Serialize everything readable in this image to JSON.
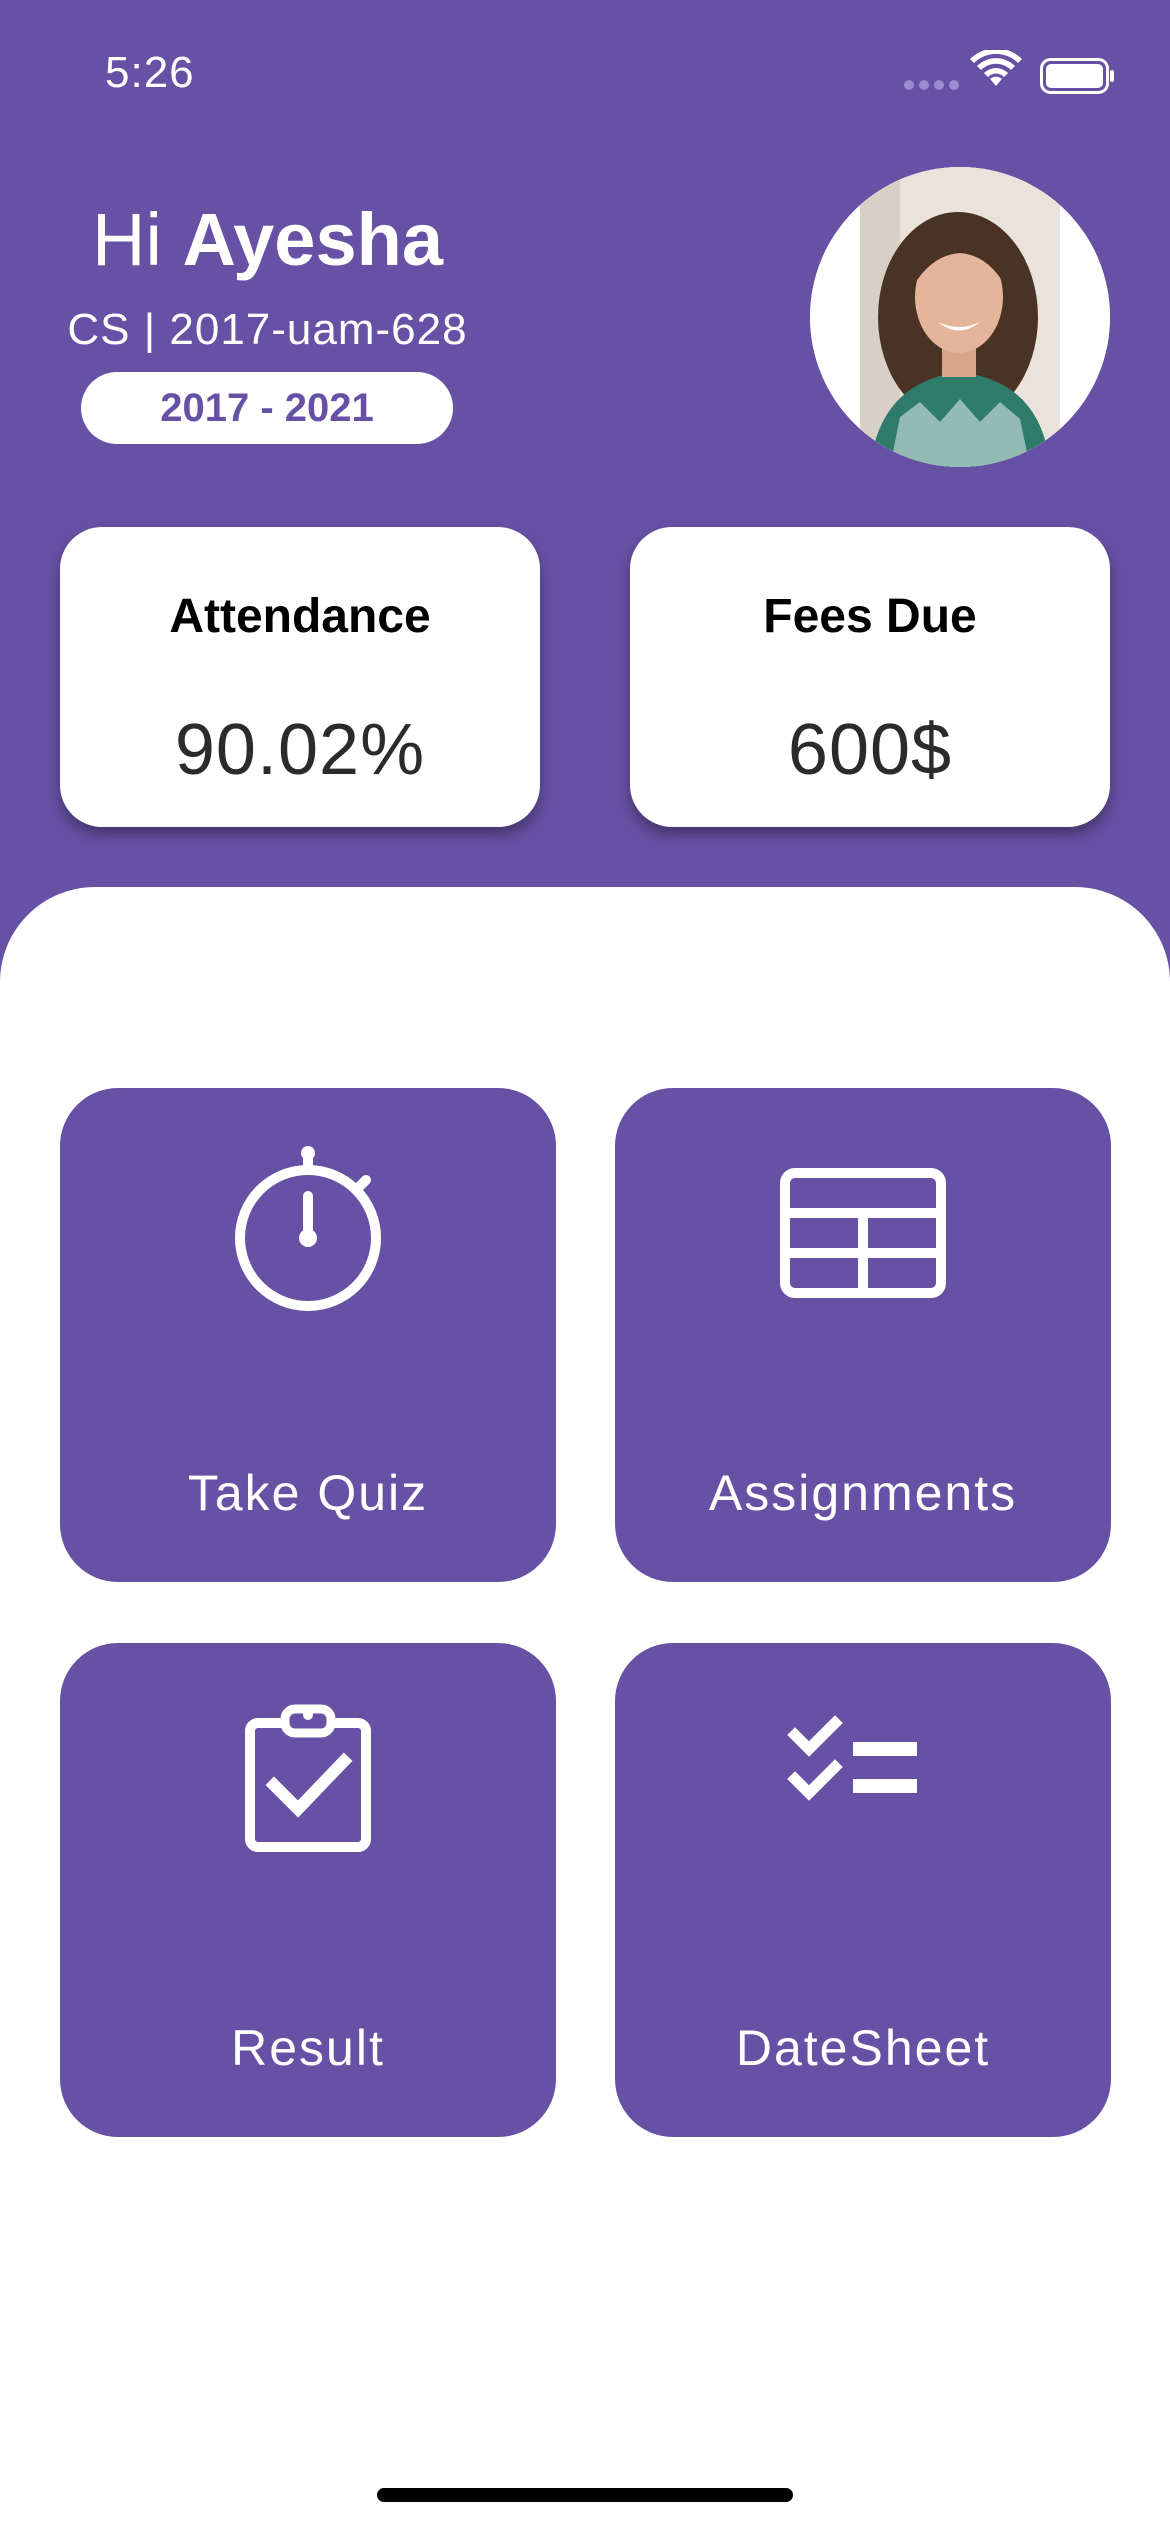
{
  "status_bar": {
    "time": "5:26"
  },
  "header": {
    "greeting": "Hi",
    "name": "Ayesha",
    "student_id": "CS | 2017-uam-628",
    "session": "2017 - 2021"
  },
  "stats": [
    {
      "title": "Attendance",
      "value": "90.02%"
    },
    {
      "title": "Fees Due",
      "value": "600$"
    }
  ],
  "tiles": [
    {
      "label": "Take Quiz",
      "icon": "stopwatch-icon"
    },
    {
      "label": "Assignments",
      "icon": "table-icon"
    },
    {
      "label": "Result",
      "icon": "clipboard-check-icon"
    },
    {
      "label": "DateSheet",
      "icon": "checklist-icon"
    }
  ],
  "colors": {
    "primary": "#6751a5",
    "background": "#ffffff",
    "card_text": "#000000"
  }
}
